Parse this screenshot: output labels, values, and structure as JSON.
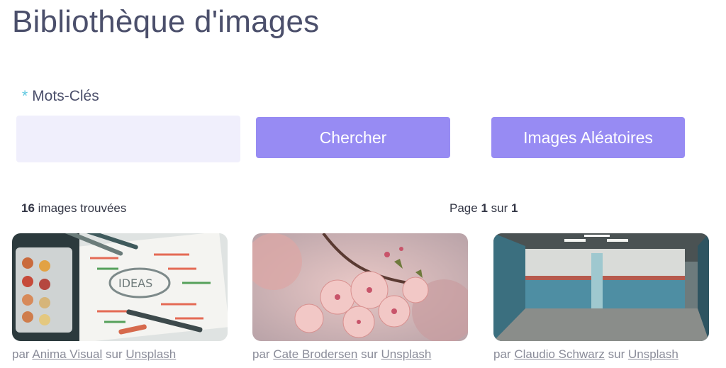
{
  "page": {
    "title": "Bibliothèque d'images"
  },
  "search": {
    "required_marker": "*",
    "label": "Mots-Clés",
    "value": "",
    "placeholder": ""
  },
  "actions": {
    "search_label": "Chercher",
    "random_label": "Images Aléatoires"
  },
  "results": {
    "count": "16",
    "count_suffix": "images trouvées",
    "page_prefix": "Page",
    "page_current": "1",
    "page_sep": "sur",
    "page_total": "1"
  },
  "images": [
    {
      "subject": "art supplies with paint palette and pens on paper",
      "credit_prefix": "par",
      "author": "Anima Visual",
      "credit_mid": "sur",
      "source": "Unsplash"
    },
    {
      "subject": "pink cherry blossoms",
      "credit_prefix": "par",
      "author": "Cate Brodersen",
      "credit_mid": "sur",
      "source": "Unsplash"
    },
    {
      "subject": "empty blue-tiled indoor room with pillar",
      "credit_prefix": "par",
      "author": "Claudio Schwarz",
      "credit_mid": "sur",
      "source": "Unsplash"
    }
  ],
  "colors": {
    "title": "#4b4f6b",
    "required": "#5fc8e0",
    "input_bg": "#f0effc",
    "button_bg": "#978bf3",
    "button_text": "#ffffff",
    "credit_text": "#8a8c99"
  }
}
